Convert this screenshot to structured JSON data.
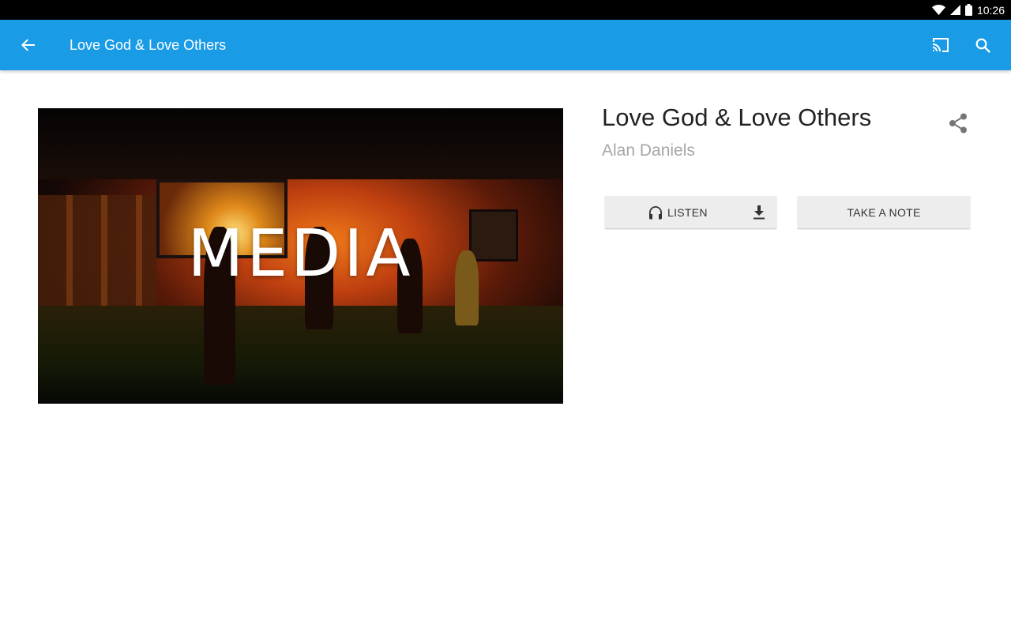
{
  "status_bar": {
    "time": "10:26",
    "icons": [
      "wifi-icon",
      "signal-icon",
      "battery-icon"
    ]
  },
  "app_bar": {
    "title": "Love God & Love Others",
    "background": "#1a9be6",
    "icons": [
      "back-arrow-icon",
      "cast-icon",
      "search-icon"
    ]
  },
  "media": {
    "overlay_text": "MEDIA"
  },
  "detail": {
    "title": "Love God & Love Others",
    "author": "Alan Daniels",
    "share_icon": "share-icon"
  },
  "actions": {
    "listen_label": "LISTEN",
    "listen_icon": "headphones-icon",
    "download_icon": "download-icon",
    "take_note_label": "TAKE A NOTE"
  }
}
